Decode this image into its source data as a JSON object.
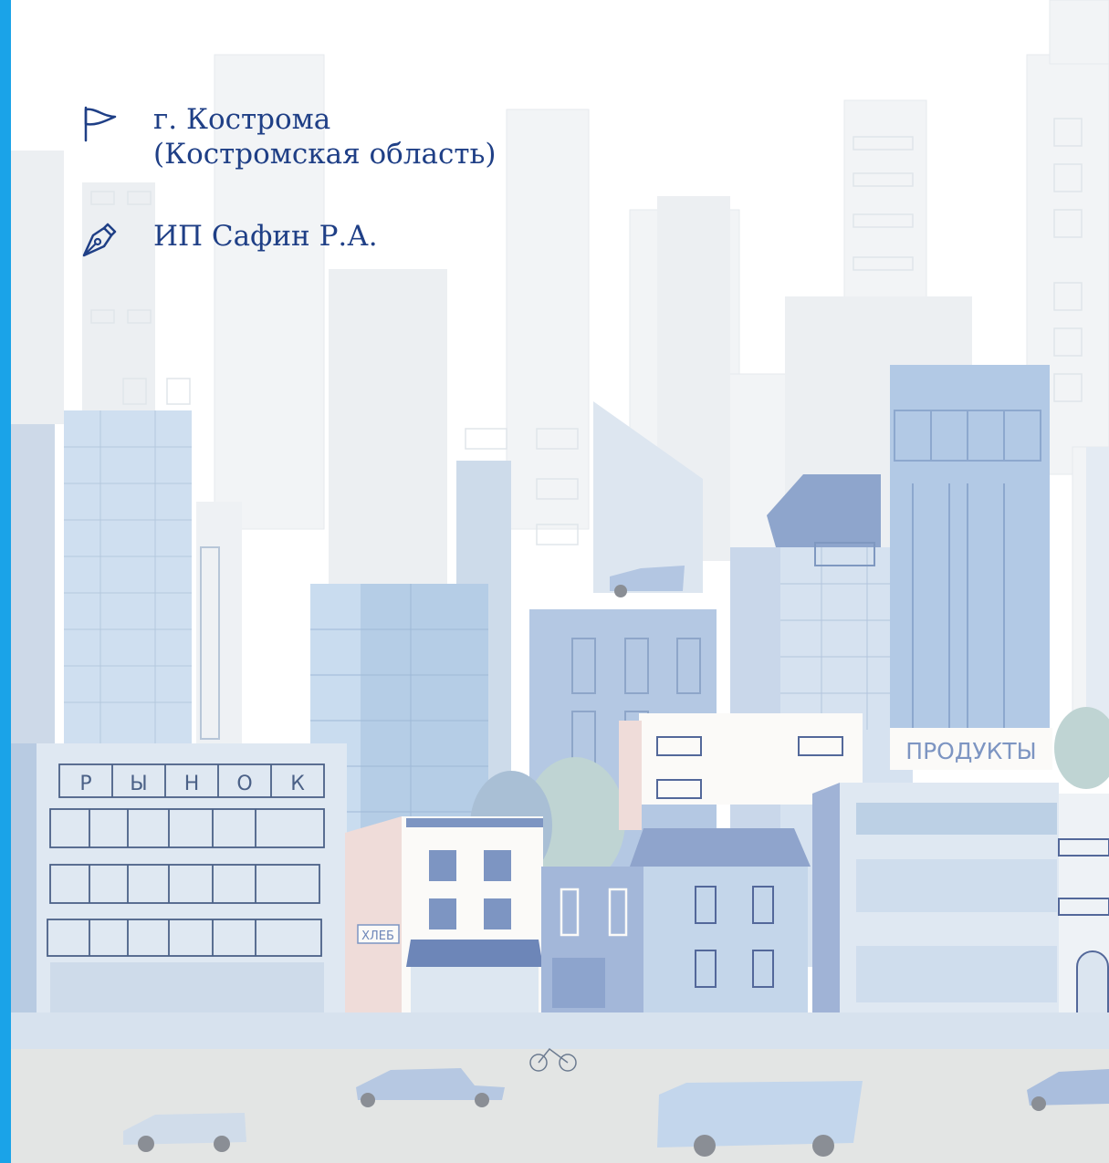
{
  "location": {
    "icon": "flag-icon",
    "line1": "г. Кострома",
    "line2": "(Костромская область)"
  },
  "author": {
    "icon": "pen-nib-icon",
    "name": "ИП Сафин Р.А."
  },
  "signs": {
    "market": [
      "Р",
      "Ы",
      "Н",
      "О",
      "К"
    ],
    "grocery": "ПРОДУКТЫ",
    "bakery": "ХЛЕБ"
  },
  "colors": {
    "accent": "#1aa3e8",
    "text": "#1f3f86",
    "road": "#e3e5e4"
  }
}
